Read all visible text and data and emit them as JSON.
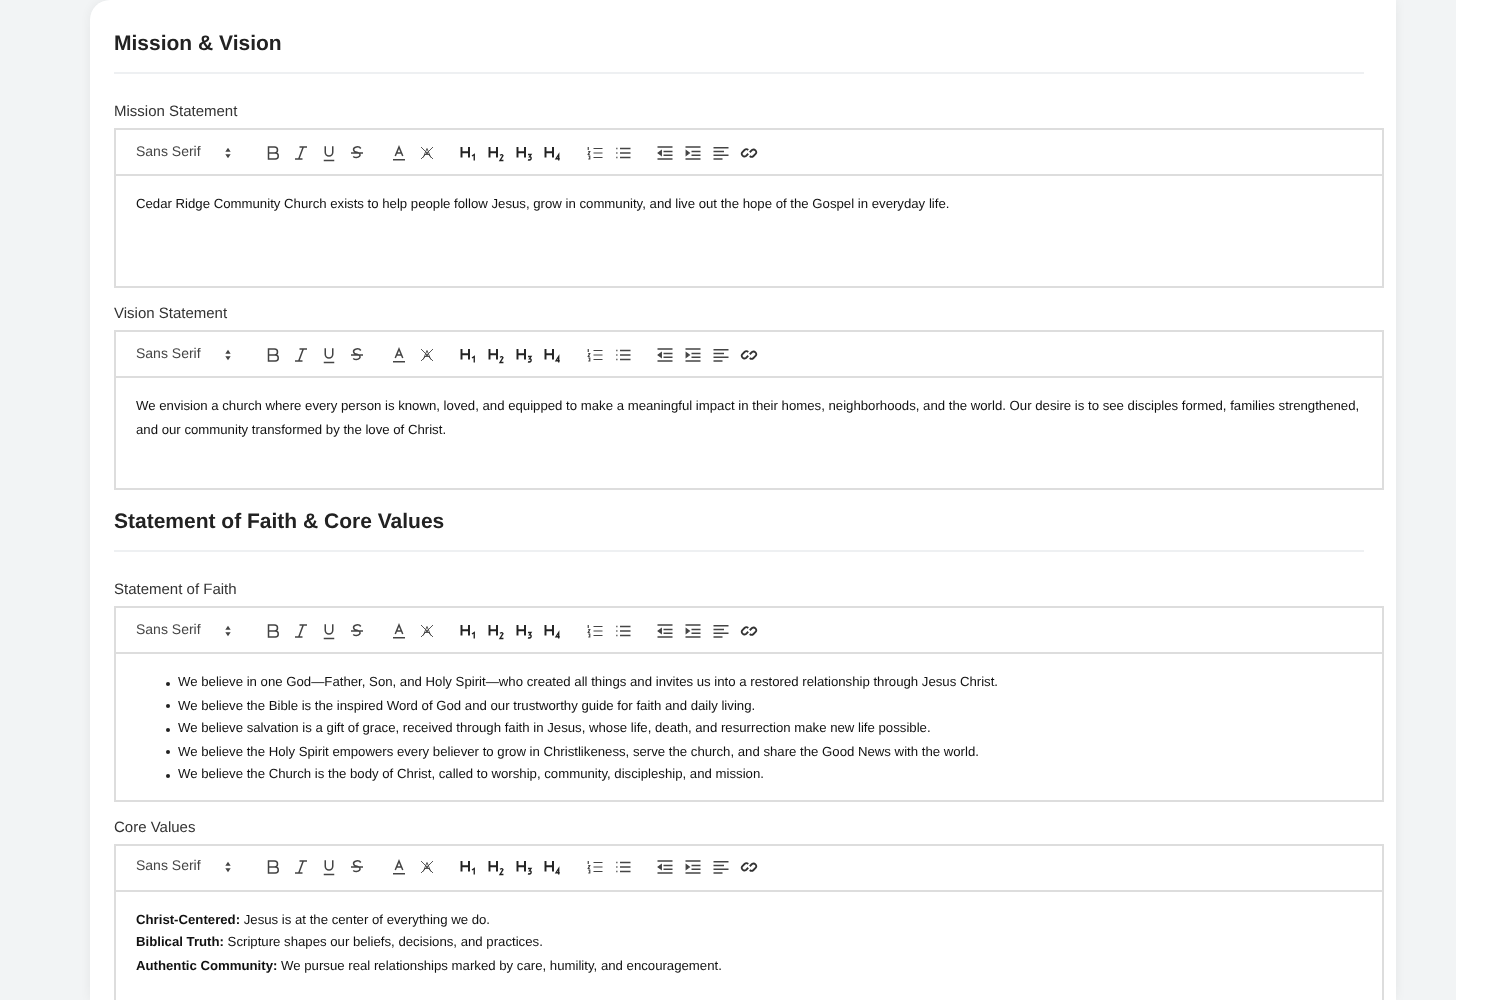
{
  "sections": [
    {
      "title": "Mission & Vision",
      "fields": [
        {
          "label": "Mission Statement",
          "font": "Sans Serif",
          "kind": "paragraphs",
          "content": [
            "Cedar Ridge Community Church exists to help people follow Jesus, grow in community, and live out the hope of the Gospel in everyday life."
          ]
        },
        {
          "label": "Vision Statement",
          "font": "Sans Serif",
          "kind": "paragraphs",
          "content": [
            "We envision a church where every person is known, loved, and equipped to make a meaningful impact in their homes, neighborhoods, and the world. Our desire is to see disciples formed, families strengthened, and our community transformed by the love of Christ."
          ]
        }
      ]
    },
    {
      "title": "Statement of Faith & Core Values",
      "fields": [
        {
          "label": "Statement of Faith",
          "font": "Sans Serif",
          "kind": "bullets",
          "content": [
            "We believe in one God—Father, Son, and Holy Spirit—who created all things and invites us into a restored relationship through Jesus Christ.",
            "We believe the Bible is the inspired Word of God and our trustworthy guide for faith and daily living.",
            "We believe salvation is a gift of grace, received through faith in Jesus, whose life, death, and resurrection make new life possible.",
            "We believe the Holy Spirit empowers every believer to grow in Christlikeness, serve the church, and share the Good News with the world.",
            "We believe the Church is the body of Christ, called to worship, community, discipleship, and mission."
          ]
        },
        {
          "label": "Core Values",
          "font": "Sans Serif",
          "kind": "lines",
          "content": [
            "**Christ-Centered:** Jesus is at the center of everything we do.",
            "**Biblical Truth:** Scripture shapes our beliefs, decisions, and practices.",
            "**Authentic Community:** We pursue real relationships marked by care, humility, and encouragement."
          ]
        }
      ]
    }
  ]
}
